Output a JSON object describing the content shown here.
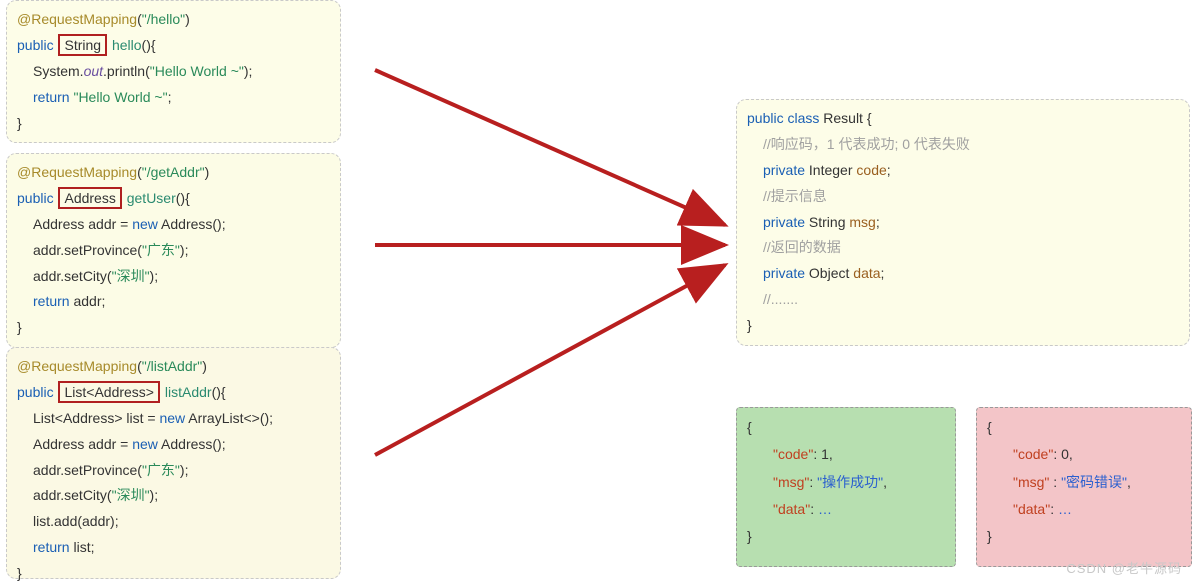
{
  "hello": {
    "annotation": "@RequestMapping",
    "path": "\"/hello\"",
    "kwPublic": "public",
    "retType": "String",
    "methodName": "hello",
    "sysOut": "System.",
    "out": "out",
    "println": ".println(",
    "helloStr": "\"Hello World ~\"",
    "return": "return ",
    "helloStr2": "\"Hello World ~\"",
    "closeParen": ");",
    "closeSemi": ";",
    "methodClose": "}",
    "parenSig": "(){"
  },
  "addr": {
    "annotation": "@RequestMapping",
    "path": "\"/getAddr\"",
    "kwPublic": "public",
    "retType": "Address",
    "methodName": "getUser",
    "parenSig": "(){",
    "l1a": "Address addr = ",
    "l1b": "new",
    "l1c": " Address();",
    "l2a": "addr.setProvince(",
    "l2b": "\"广东\"",
    "l2c": ");",
    "l3a": "addr.setCity(",
    "l3b": "\"深圳\"",
    "l3c": ");",
    "l4a": "return ",
    "l4b": "addr;",
    "methodClose": "}"
  },
  "list": {
    "annotation": "@RequestMapping",
    "path": "\"/listAddr\"",
    "kwPublic": "public",
    "retType": "List<Address>",
    "methodName": "listAddr",
    "parenSig": "(){",
    "l1a": "List<Address> list = ",
    "l1b": "new",
    "l1c": " ArrayList<>();",
    "l2a": "Address addr = ",
    "l2b": "new",
    "l2c": " Address();",
    "l3a": "addr.setProvince(",
    "l3b": "\"广东\"",
    "l3c": ");",
    "l4a": "addr.setCity(",
    "l4b": "\"深圳\"",
    "l4c": ");",
    "l5": "list.add(addr);",
    "l6a": "return ",
    "l6b": "list;",
    "methodClose": "}"
  },
  "result": {
    "kwPublic": "public ",
    "kwClass": "class",
    "className": " Result {",
    "c1": "//响应码，1 代表成功; 0 代表失败",
    "kwPrivate": "private",
    "t1": " Integer ",
    "f1": "code",
    "semi": ";",
    "c2": "//提示信息",
    "t2": " String ",
    "f2": "msg",
    "c3": "//返回的数据",
    "t3": " Object ",
    "f3": "data",
    "c4": "//.......",
    "close": "}"
  },
  "jsonGreen": {
    "open": "{",
    "k1": "\"code\"",
    "v1": "1",
    "k2": "\"msg\"",
    "v2": "\"操作成功\"",
    "k3": "\"data\"",
    "dots": "…",
    "colon": ": ",
    "colonSp": " : ",
    "comma": ",",
    "close": "}"
  },
  "jsonRed": {
    "open": "{",
    "k1": "\"code\"",
    "v1": "0",
    "k2": "\"msg\"",
    "v2": "\"密码错误\"",
    "k3": "\"data\"",
    "dots": "…",
    "colon": ": ",
    "colonSp": " : ",
    "comma": ",",
    "close": "}"
  },
  "watermark": "CSDN @老牛源码"
}
